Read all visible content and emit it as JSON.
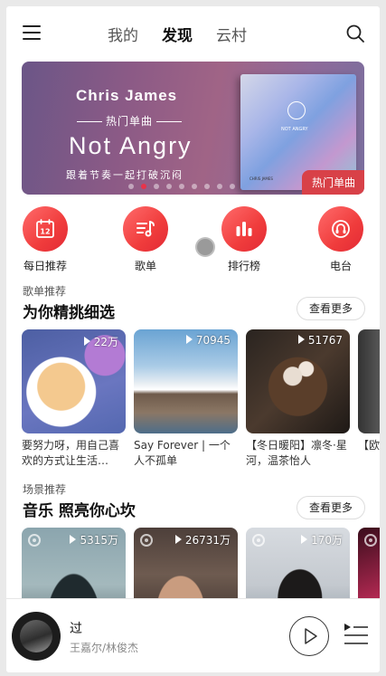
{
  "header": {
    "tabs": [
      {
        "label": "我的",
        "active": false
      },
      {
        "label": "发现",
        "active": true
      },
      {
        "label": "云村",
        "active": false
      }
    ],
    "icons": {
      "menu": "menu-icon",
      "search": "search-icon"
    }
  },
  "banner": {
    "artist": "Chris James",
    "subtitle": "热门单曲",
    "title": "Not Angry",
    "slogan": "跟着节奏一起打破沉闷",
    "tag": "热门单曲",
    "album_text": "NOT ANGRY",
    "album_artist": "CHRIS JAMES",
    "dots_total": 9,
    "active_dot": 1
  },
  "quick_nav": [
    {
      "label": "每日推荐",
      "icon": "calendar-icon",
      "icon_text": "12"
    },
    {
      "label": "歌单",
      "icon": "playlist-icon"
    },
    {
      "label": "排行榜",
      "icon": "chart-bars-icon"
    },
    {
      "label": "电台",
      "icon": "radio-icon"
    }
  ],
  "playlists": {
    "subtitle": "歌单推荐",
    "title": "为你精挑细选",
    "more": "查看更多",
    "items": [
      {
        "count": "22万",
        "name": "要努力呀，用自己喜欢的方式让生活…"
      },
      {
        "count": "70945",
        "name": "Say Forever | 一个人不孤单"
      },
      {
        "count": "51767",
        "name": "【冬日暖阳】凛冬·星河，温茶怡人"
      },
      {
        "count": "",
        "name": "【欧美】嗓…"
      }
    ]
  },
  "scenes": {
    "subtitle": "场景推荐",
    "title": "音乐 照亮你心坎",
    "more": "查看更多",
    "items": [
      {
        "count": "5315万"
      },
      {
        "count": "26731万"
      },
      {
        "count": "170万"
      },
      {
        "count": ""
      }
    ]
  },
  "player": {
    "song": "过",
    "artist": "王嘉尔/林俊杰"
  },
  "colors": {
    "accent": "#e8334a",
    "tag": "#d84148"
  }
}
